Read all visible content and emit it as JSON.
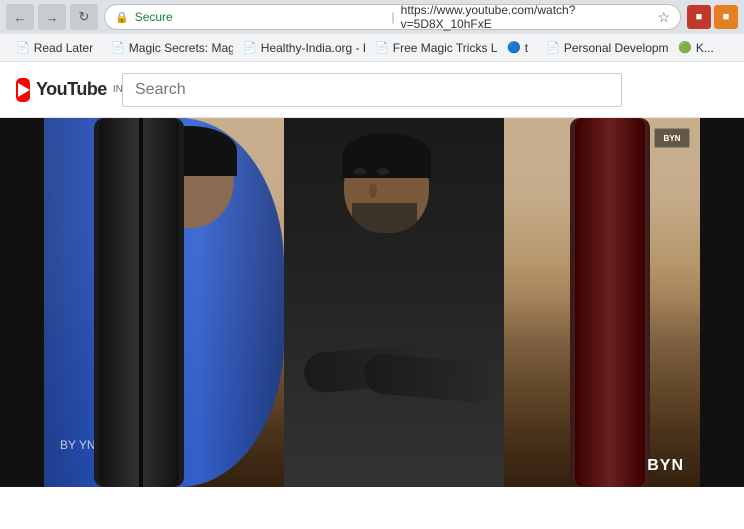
{
  "browser": {
    "nav": {
      "back_label": "←",
      "forward_label": "→",
      "refresh_label": "↻",
      "home_label": "⌂"
    },
    "address_bar": {
      "secure_label": "🔒",
      "secure_text": "Secure",
      "url": "https://www.youtube.com/watch?v=5D8X_10hFxE",
      "separator": "|"
    },
    "star_icon": "☆",
    "extensions": [
      {
        "name": "red-extension",
        "symbol": "■"
      },
      {
        "name": "orange-extension",
        "symbol": "■"
      }
    ],
    "bookmarks": [
      {
        "name": "read-later",
        "label": "Read Later",
        "icon": "📄"
      },
      {
        "name": "magic-secrets",
        "label": "Magic Secrets: Magic...",
        "icon": "📄"
      },
      {
        "name": "healthy-india",
        "label": "Healthy-India.org - H...",
        "icon": "📄"
      },
      {
        "name": "free-magic-tricks",
        "label": "Free Magic Tricks Lea...",
        "icon": "📄"
      },
      {
        "name": "personal-dev-t",
        "label": "t",
        "icon": "🔵"
      },
      {
        "name": "personal-development",
        "label": "Personal Developme...",
        "icon": "📄"
      },
      {
        "name": "k-bookmark",
        "label": "K...",
        "icon": "🟢"
      }
    ]
  },
  "youtube": {
    "logo": {
      "wordmark": "YouTube",
      "country_code": "IN"
    },
    "search": {
      "placeholder": "Search"
    },
    "video": {
      "watermark": "BYN",
      "small_watermark": "BYN",
      "caption": "BY YNWUNM"
    }
  }
}
